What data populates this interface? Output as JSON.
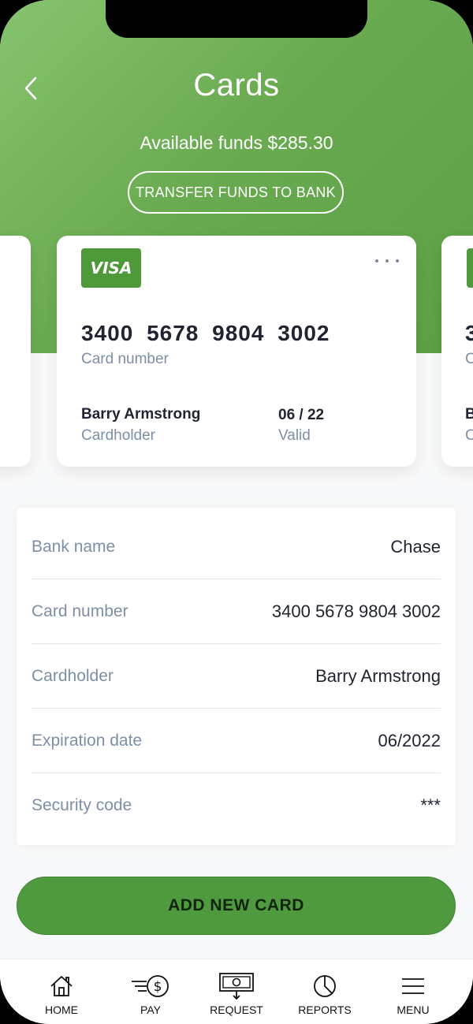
{
  "header": {
    "title": "Cards",
    "available_funds": "Available funds $285.30",
    "transfer_label": "TRANSFER FUNDS TO BANK"
  },
  "card": {
    "brand": "VISA",
    "number": "3400 5678 9804 3002",
    "number_label": "Card number",
    "holder": "Barry Armstrong",
    "holder_label": "Cardholder",
    "valid": "06 / 22",
    "valid_label": "Valid"
  },
  "details": [
    {
      "label": "Bank name",
      "value": "Chase"
    },
    {
      "label": "Card number",
      "value": "3400 5678 9804 3002"
    },
    {
      "label": "Cardholder",
      "value": "Barry Armstrong"
    },
    {
      "label": "Expiration date",
      "value": "06/2022"
    },
    {
      "label": "Security code",
      "value": "***"
    }
  ],
  "add_card_label": "ADD NEW CARD",
  "tabs": [
    {
      "label": "HOME",
      "icon": "home-icon"
    },
    {
      "label": "PAY",
      "icon": "pay-icon"
    },
    {
      "label": "REQUEST",
      "icon": "request-icon"
    },
    {
      "label": "REPORTS",
      "icon": "reports-icon"
    },
    {
      "label": "MENU",
      "icon": "menu-icon"
    }
  ],
  "colors": {
    "brand_green": "#5b9f44",
    "button_green": "#4f9a3e",
    "label_gray": "#7d8fa6"
  }
}
